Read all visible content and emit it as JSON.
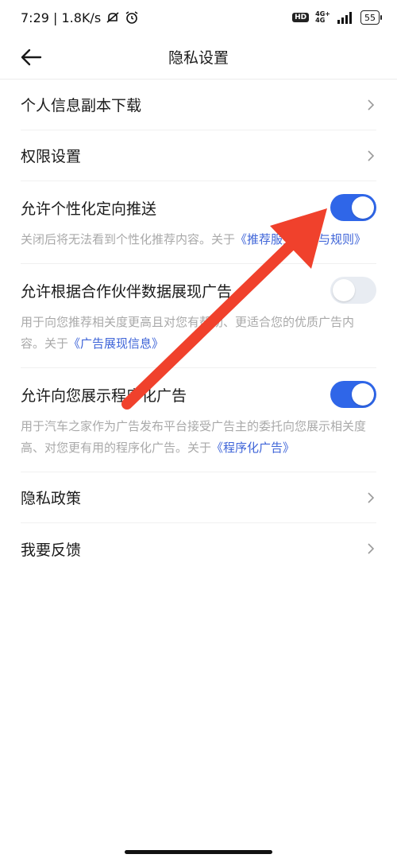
{
  "status_bar": {
    "time_speed": "7:29 | 1.8K/s",
    "battery": "55",
    "network_top": "4G+",
    "network_bottom": "4G",
    "hd": "HD"
  },
  "nav": {
    "title": "隐私设置"
  },
  "menu_items": [
    {
      "label": "个人信息副本下载"
    },
    {
      "label": "权限设置"
    }
  ],
  "toggles": [
    {
      "label": "允许个性化定向推送",
      "enabled": true,
      "desc": "关闭后将无法看到个性化推荐内容。关于",
      "link": "《推荐服务机制与规则》"
    },
    {
      "label": "允许根据合作伙伴数据展现广告",
      "enabled": false,
      "desc": "用于向您推荐相关度更高且对您有帮助、更适合您的优质广告内容。关于",
      "link": "《广告展现信息》"
    },
    {
      "label": "允许向您展示程序化广告",
      "enabled": true,
      "desc": "用于汽车之家作为广告发布平台接受广告主的委托向您展示相关度高、对您更有用的程序化广告。关于",
      "link": "《程序化广告》"
    }
  ],
  "bottom_items": [
    {
      "label": "隐私政策"
    },
    {
      "label": "我要反馈"
    }
  ],
  "colors": {
    "accent": "#2f66e8",
    "link": "#3e64d8",
    "annotation_arrow": "#f0412c"
  }
}
